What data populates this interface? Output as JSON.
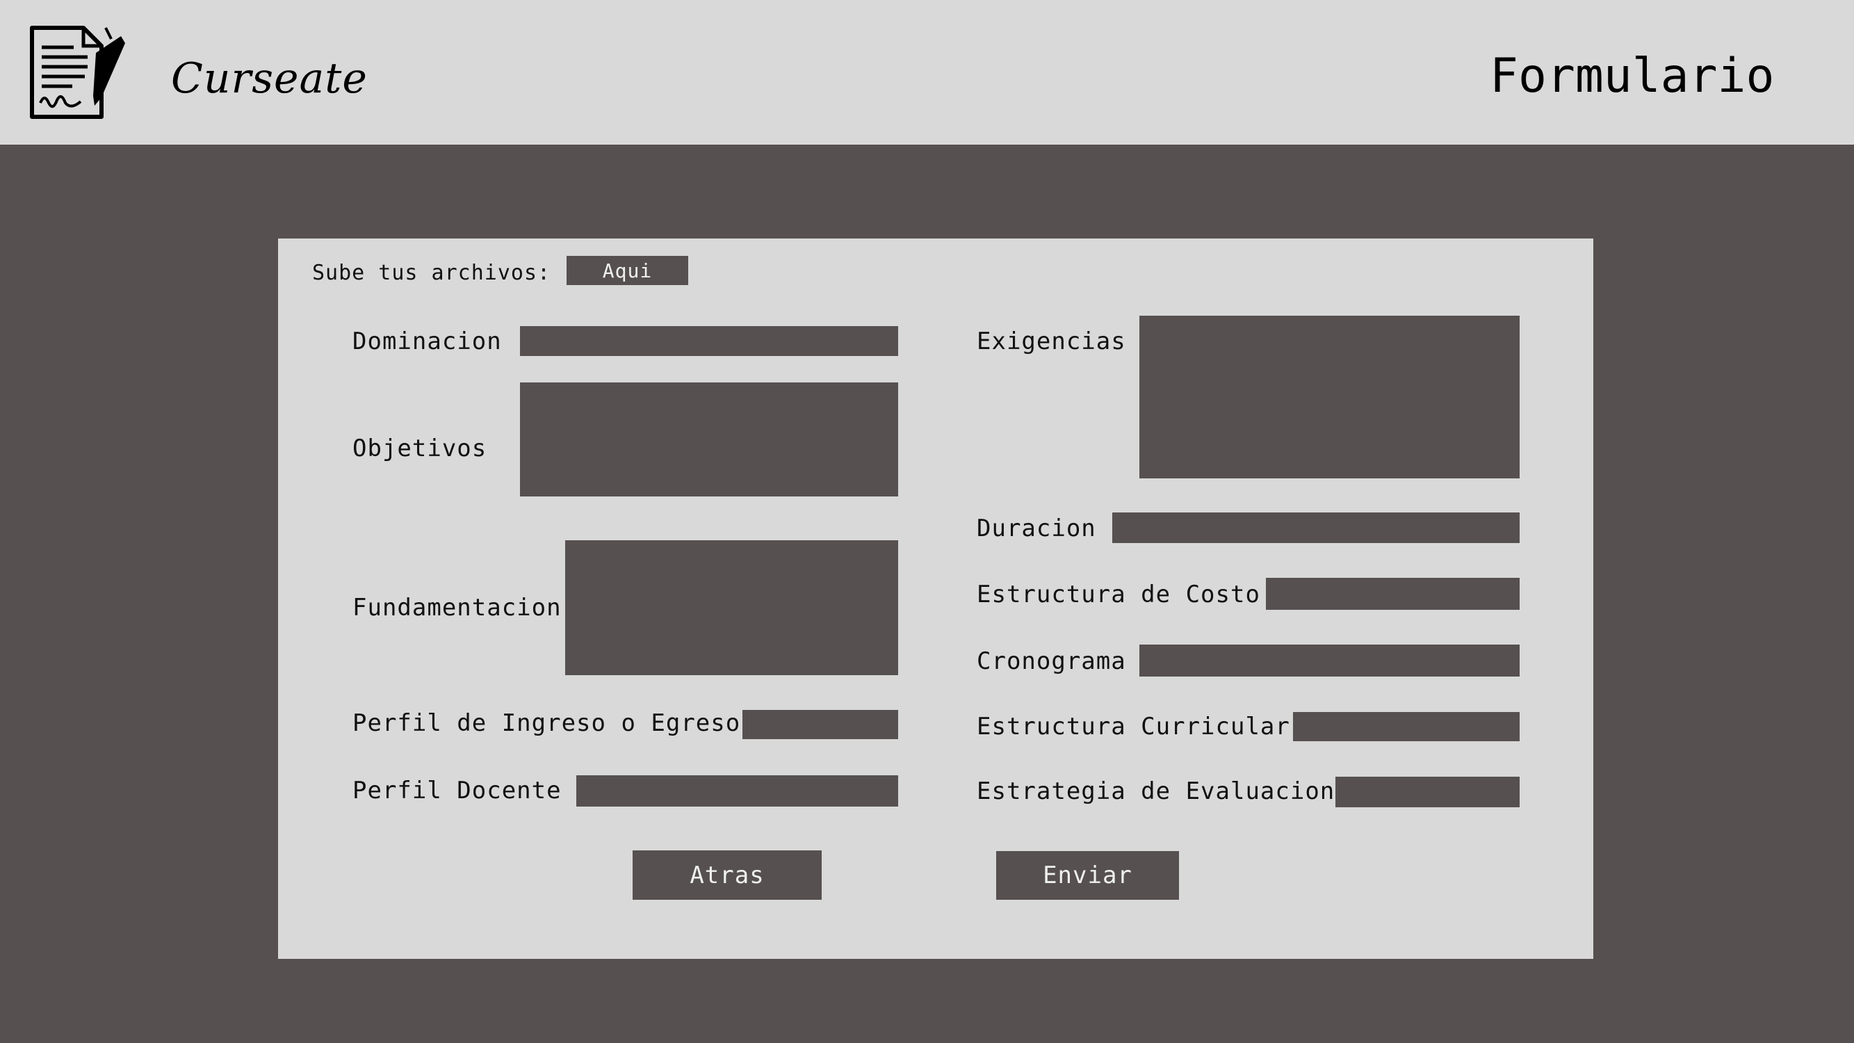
{
  "header": {
    "brand": "Curseate",
    "title": "Formulario",
    "logo_icon": "document-with-pen-icon"
  },
  "upload": {
    "label": "Sube tus archivos:",
    "button": "Aqui"
  },
  "form": {
    "left": {
      "dominacion": "Dominacion",
      "objetivos": "Objetivos",
      "fundamentacion": "Fundamentacion",
      "perfil_ingreso": "Perfil de Ingreso o Egreso",
      "perfil_docente": "Perfil Docente"
    },
    "right": {
      "exigencias": "Exigencias",
      "duracion": "Duracion",
      "estructura_costo": "Estructura de Costo",
      "cronograma": "Cronograma",
      "estructura_curricular": "Estructura Curricular",
      "estrategia_evaluacion": "Estrategia de Evaluacion"
    }
  },
  "buttons": {
    "back": "Atras",
    "submit": "Enviar"
  },
  "colors": {
    "background": "#565050",
    "panel": "#d9d9d9",
    "field": "#565050"
  }
}
